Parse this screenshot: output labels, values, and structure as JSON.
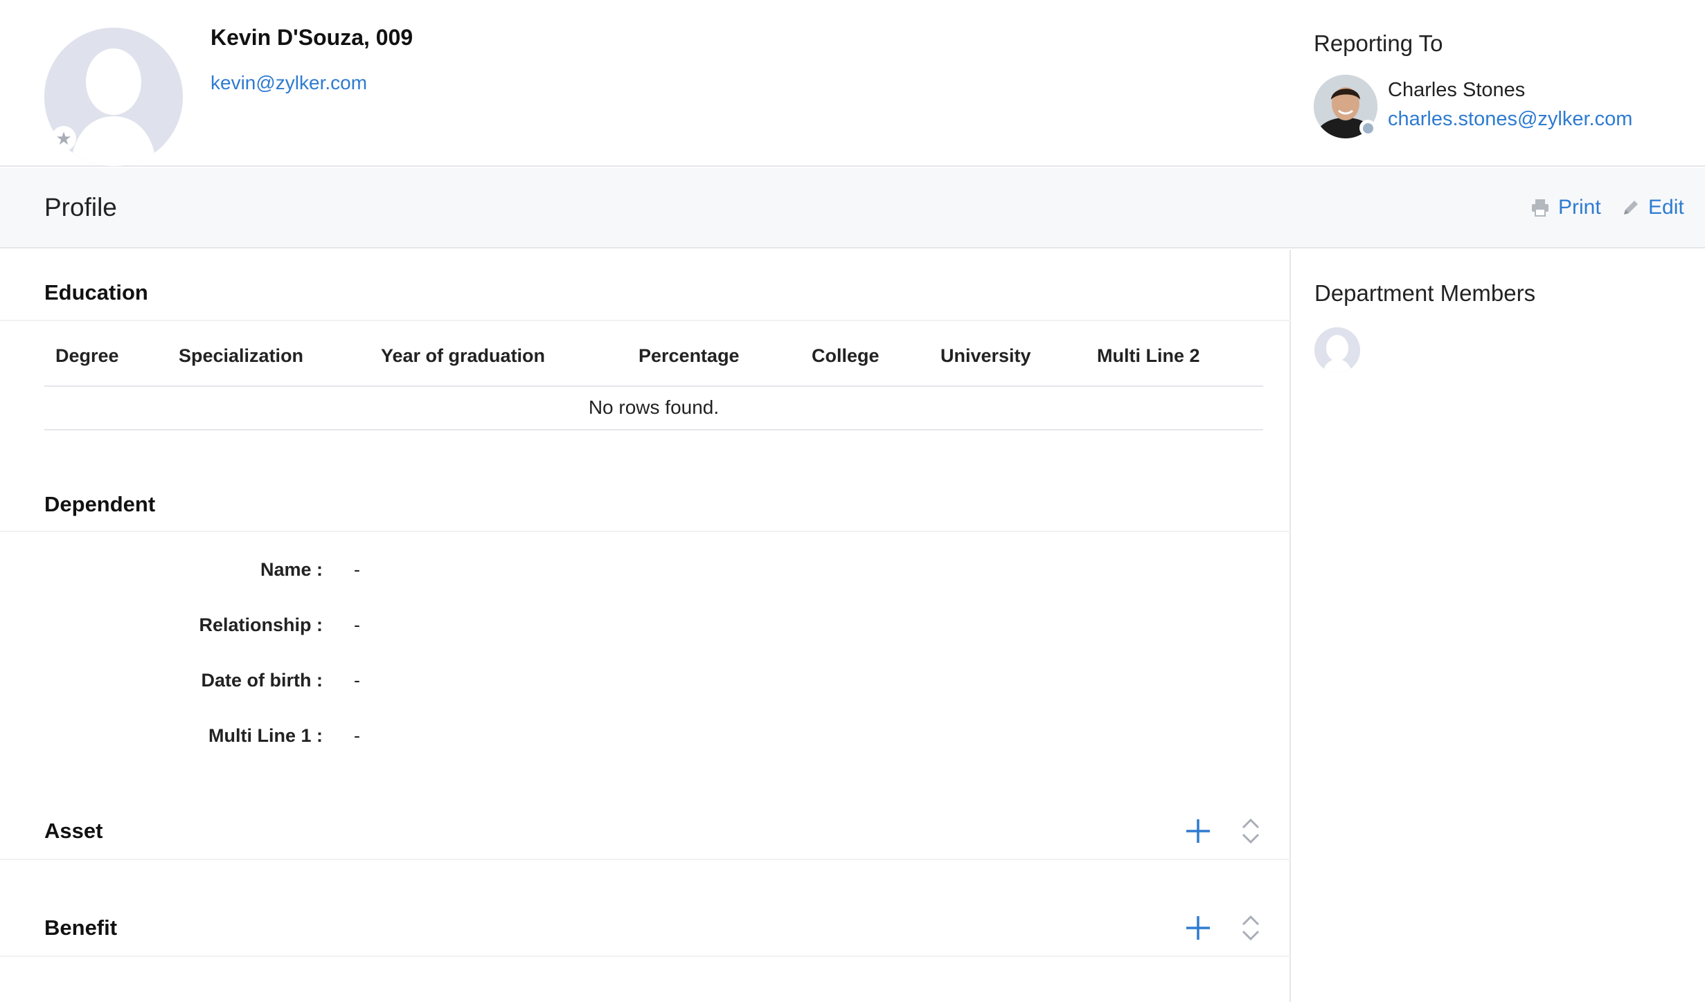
{
  "employee": {
    "name": "Kevin D'Souza, 009",
    "email": "kevin@zylker.com"
  },
  "reporting": {
    "title": "Reporting To",
    "name": "Charles Stones",
    "email": "charles.stones@zylker.com"
  },
  "profile_bar": {
    "title": "Profile",
    "print_label": "Print",
    "edit_label": "Edit"
  },
  "education": {
    "title": "Education",
    "columns": [
      "Degree",
      "Specialization",
      "Year of graduation",
      "Percentage",
      "College",
      "University",
      "Multi Line 2"
    ],
    "empty_text": "No rows found."
  },
  "dependent": {
    "title": "Dependent",
    "fields": [
      {
        "label": "Name :",
        "value": "-"
      },
      {
        "label": "Relationship :",
        "value": "-"
      },
      {
        "label": "Date of birth :",
        "value": "-"
      },
      {
        "label": "Multi Line 1 :",
        "value": "-"
      }
    ]
  },
  "asset": {
    "title": "Asset"
  },
  "benefit": {
    "title": "Benefit"
  },
  "sidebar": {
    "title": "Department Members"
  },
  "colors": {
    "accent": "#2e7bd1",
    "avatar_bg": "#dfe2ec",
    "divider": "#e4e6ea"
  },
  "icons": {
    "favorite": "star-icon",
    "print": "printer-icon",
    "edit": "pencil-icon",
    "add": "plus-icon",
    "sort": "sort-chevrons-icon"
  }
}
